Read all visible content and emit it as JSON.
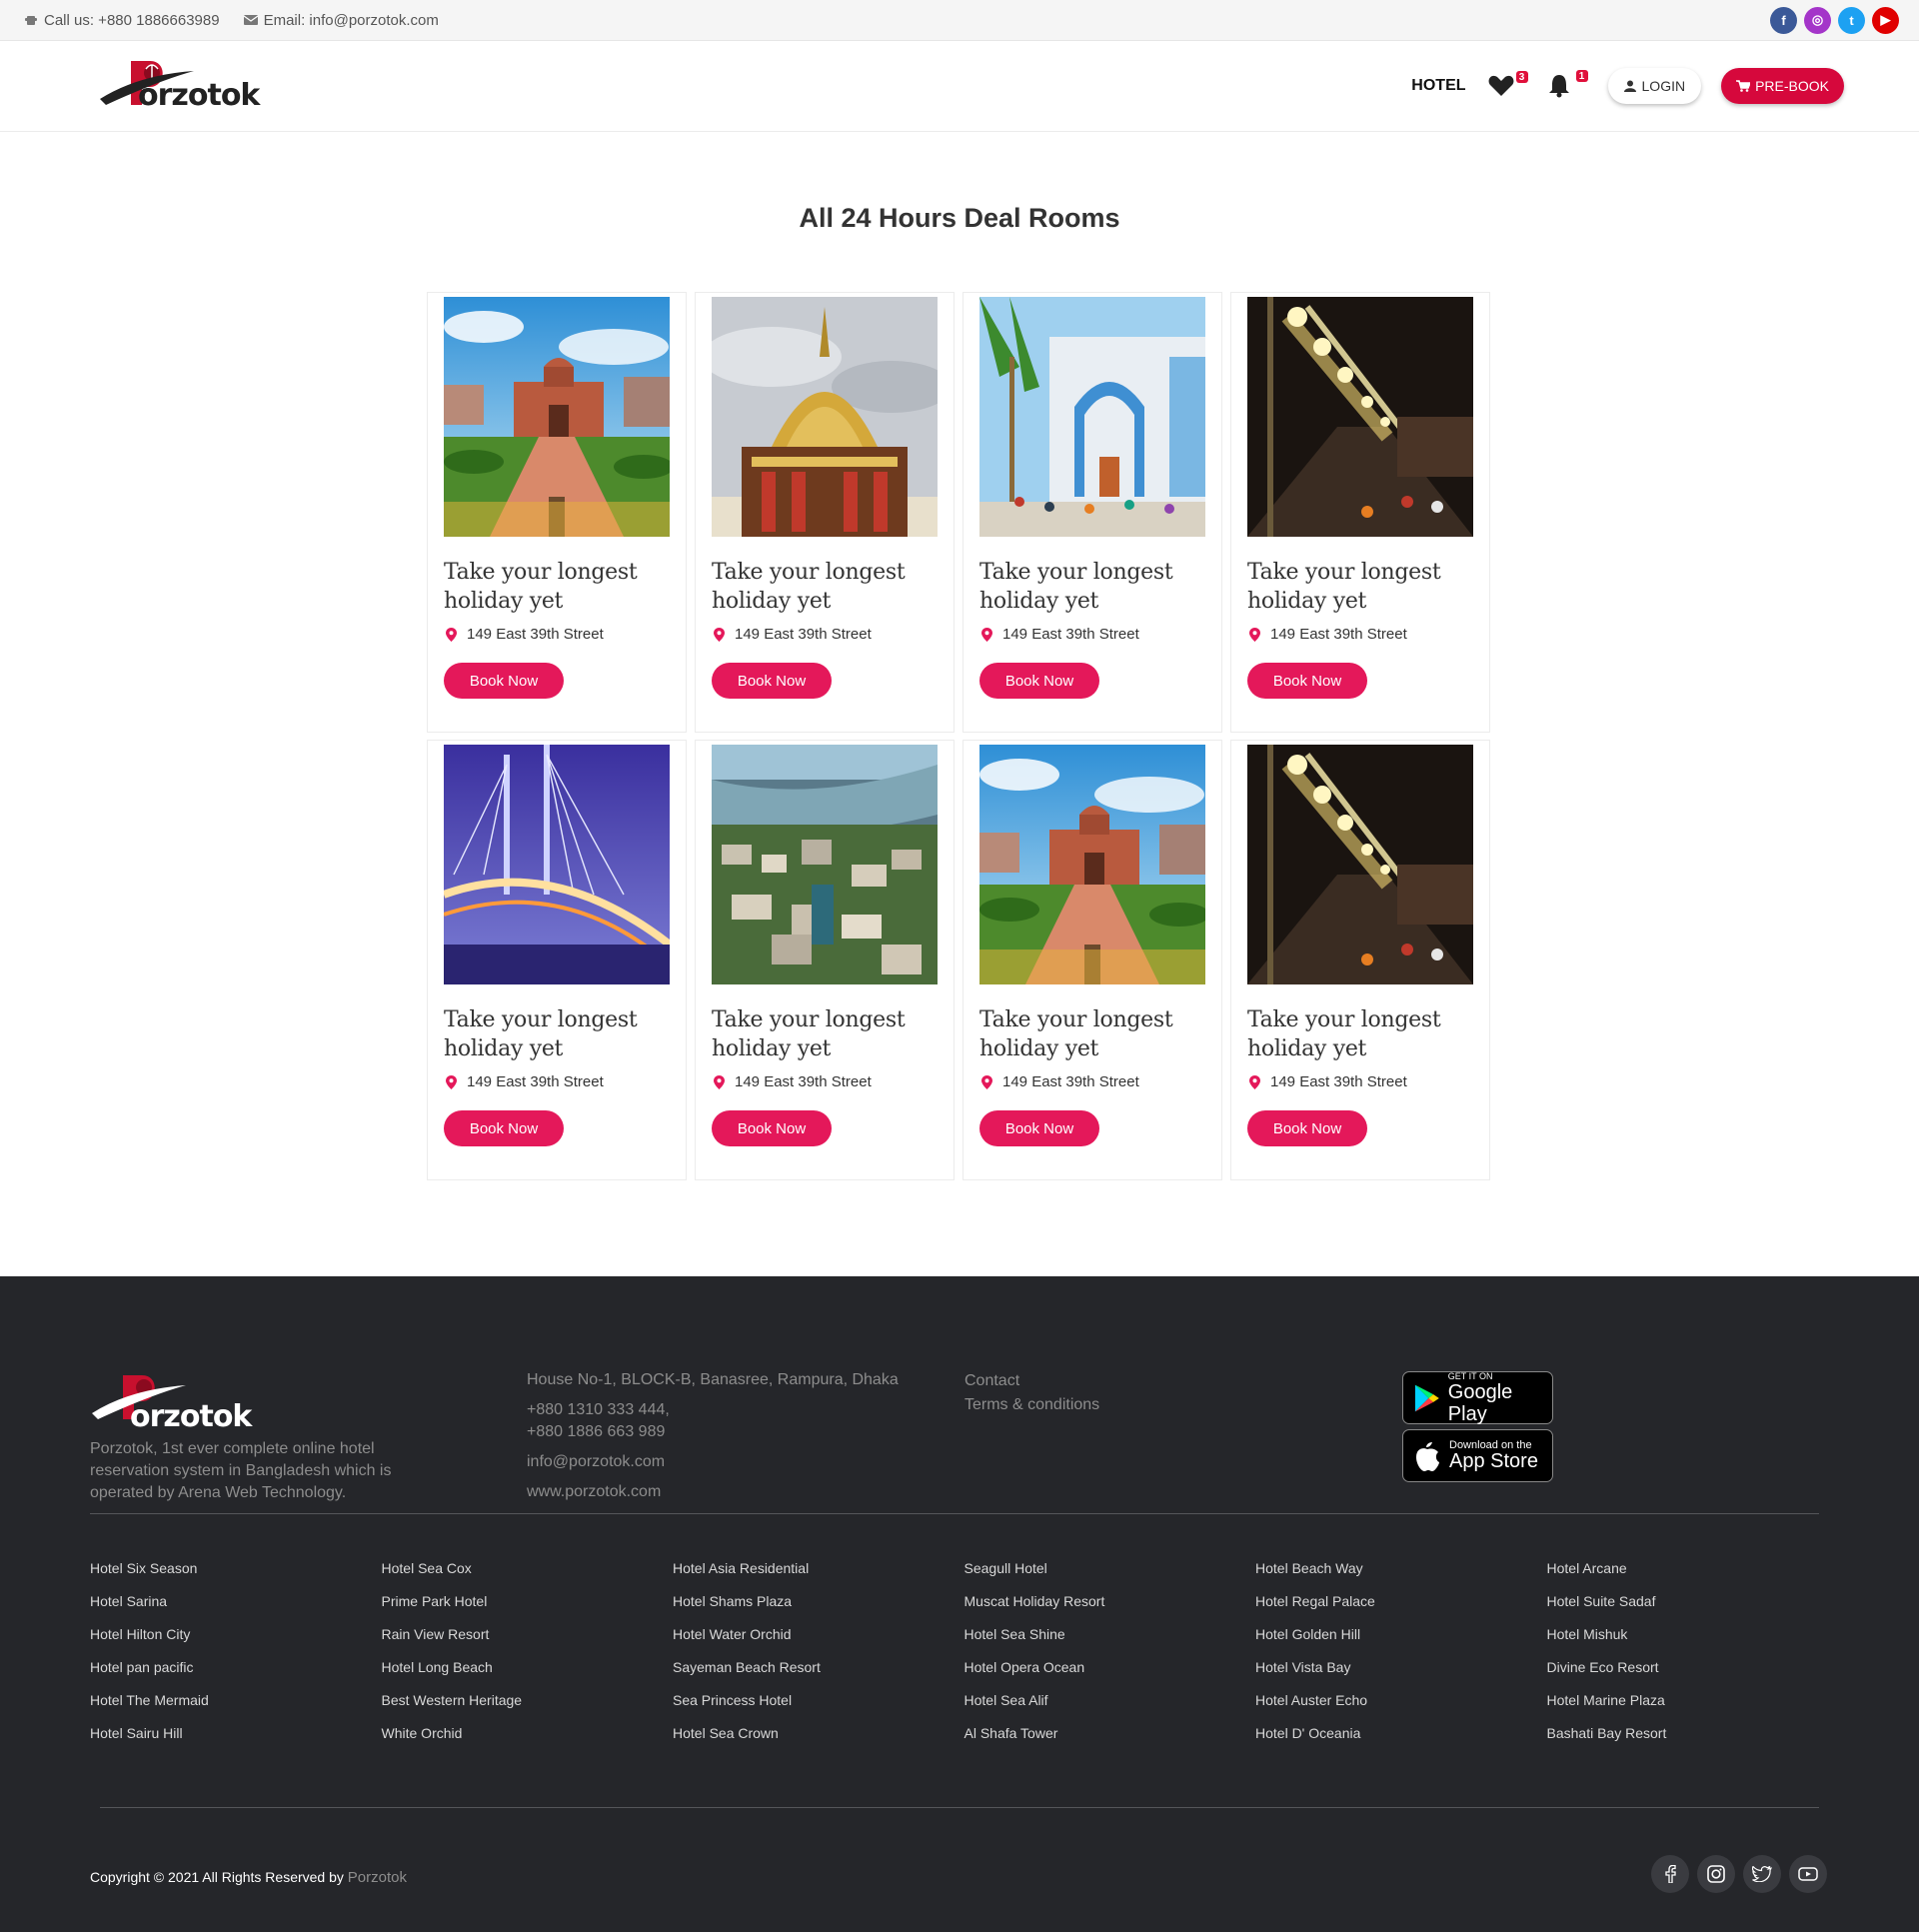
{
  "topbar": {
    "call": "Call us: +880 1886663989",
    "email": "Email: info@porzotok.com",
    "social": [
      {
        "icon": "facebook-icon",
        "color": "#3b5998",
        "glyph": "f"
      },
      {
        "icon": "instagram-icon",
        "color": "#a435c9",
        "glyph": "◎"
      },
      {
        "icon": "twitter-icon",
        "color": "#1da1f2",
        "glyph": "t"
      },
      {
        "icon": "youtube-icon",
        "color": "#e00000",
        "glyph": "▶"
      }
    ]
  },
  "header": {
    "logo_text": "orzotok",
    "nav_hotel": "HOTEL",
    "wishlist_count": "3",
    "notification_count": "1",
    "login": "LOGIN",
    "prebook": "PRE-BOOK",
    "accent": "#d6083c"
  },
  "main": {
    "title": "All 24 Hours Deal Rooms",
    "cards": [
      {
        "title": "Take your longest holiday yet",
        "address": "149 East 39th Street",
        "button": "Book Now",
        "image": "fort-garden"
      },
      {
        "title": "Take your longest holiday yet",
        "address": "149 East 39th Street",
        "button": "Book Now",
        "image": "golden-pagoda"
      },
      {
        "title": "Take your longest holiday yet",
        "address": "149 East 39th Street",
        "button": "Book Now",
        "image": "blue-mosque"
      },
      {
        "title": "Take your longest holiday yet",
        "address": "149 East 39th Street",
        "button": "Book Now",
        "image": "night-street"
      },
      {
        "title": "Take your longest holiday yet",
        "address": "149 East 39th Street",
        "button": "Book Now",
        "image": "bridge"
      },
      {
        "title": "Take your longest holiday yet",
        "address": "149 East 39th Street",
        "button": "Book Now",
        "image": "aerial-city"
      },
      {
        "title": "Take your longest holiday yet",
        "address": "149 East 39th Street",
        "button": "Book Now",
        "image": "fort-garden"
      },
      {
        "title": "Take your longest holiday yet",
        "address": "149 East 39th Street",
        "button": "Book Now",
        "image": "night-street"
      }
    ]
  },
  "footer": {
    "logo_text": "orzotok",
    "description": "Porzotok, 1st ever complete online hotel reservation system in Bangladesh which is operated by Arena Web Technology.",
    "address": "House No-1, BLOCK-B, Banasree, Rampura, Dhaka",
    "phone1": "+880 1310 333 444,",
    "phone2": "+880 1886 663 989",
    "email": "info@porzotok.com",
    "website": "www.porzotok.com",
    "links": [
      "Contact",
      "Terms & conditions"
    ],
    "google_play": {
      "small": "GET IT ON",
      "big": "Google Play"
    },
    "app_store": {
      "small": "Download on the",
      "big": "App Store"
    },
    "hotels": [
      [
        "Hotel Six Season",
        "Hotel Sarina",
        "Hotel Hilton City",
        "Hotel pan pacific",
        "Hotel The Mermaid",
        "Hotel Sairu Hill"
      ],
      [
        "Hotel Sea Cox",
        "Prime Park Hotel",
        "Rain View Resort",
        "Hotel Long Beach",
        "Best Western Heritage",
        "White Orchid"
      ],
      [
        "Hotel Asia Residential",
        "Hotel Shams Plaza",
        "Hotel Water Orchid",
        "Sayeman Beach Resort",
        "Sea Princess Hotel",
        "Hotel Sea Crown"
      ],
      [
        "Seagull Hotel",
        "Muscat Holiday Resort",
        "Hotel Sea Shine",
        "Hotel Opera Ocean",
        "Hotel Sea Alif",
        "Al Shafa Tower"
      ],
      [
        "Hotel Beach Way",
        "Hotel Regal Palace",
        "Hotel Golden Hill",
        "Hotel Vista Bay",
        "Hotel Auster Echo",
        "Hotel D' Oceania"
      ],
      [
        "Hotel Arcane",
        "Hotel Suite Sadaf",
        "Hotel Mishuk",
        "Divine Eco Resort",
        "Hotel Marine Plaza",
        "Bashati Bay Resort"
      ]
    ],
    "copyright": "Copyright © 2021 All Rights Reserved by",
    "copyright_brand": "Porzotok",
    "social": [
      "facebook-icon",
      "instagram-icon",
      "twitter-icon",
      "youtube-icon"
    ]
  }
}
